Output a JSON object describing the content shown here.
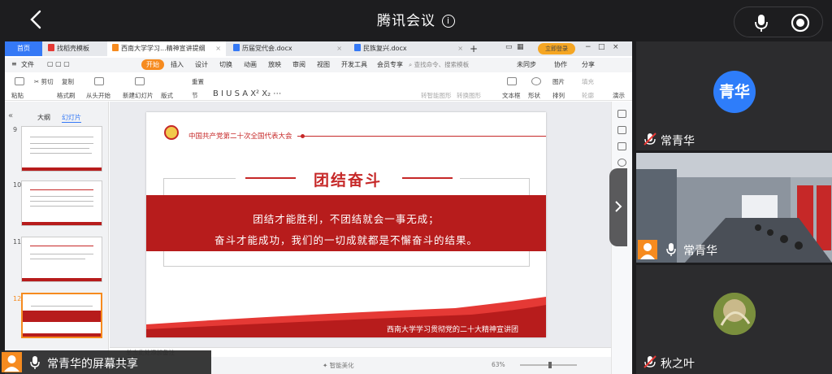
{
  "meeting": {
    "title": "腾讯会议",
    "info_icon": "info-icon"
  },
  "ppt": {
    "tabs": [
      {
        "label": "首页"
      },
      {
        "label": "找稻壳模板"
      },
      {
        "label": "西南大学学习...精神宣讲提纲"
      },
      {
        "label": "历届党代会.docx"
      },
      {
        "label": "民族复兴.docx"
      }
    ],
    "login_label": "立即登录",
    "menu": [
      "文件",
      "开始",
      "插入",
      "设计",
      "切换",
      "动画",
      "放映",
      "审阅",
      "视图",
      "开发工具",
      "会员专享"
    ],
    "search_placeholder": "查找命令、搜索模板",
    "right_actions": [
      "未同步",
      "协作",
      "分享"
    ],
    "ribbon": {
      "paste": "粘贴",
      "cut": "剪切",
      "copy": "复制",
      "format_painter": "格式刷",
      "from_start": "从头开始",
      "new_slide": "新建幻灯片",
      "layout": "版式",
      "section": "节",
      "reset": "重置",
      "textbox": "文本框",
      "shape": "形状",
      "picture": "图片",
      "fill": "填充",
      "arrange": "排列",
      "outline": "轮廓",
      "present": "演示",
      "smart_shape": "转智能图形",
      "convert_graphic": "转换图形"
    },
    "sidebar": {
      "tabs": [
        "大纲",
        "幻灯片"
      ],
      "slides": [
        {
          "num": "9"
        },
        {
          "num": "10"
        },
        {
          "num": "11"
        },
        {
          "num": "12"
        }
      ]
    },
    "slide": {
      "header": "中国共产党第二十次全国代表大会",
      "title": "团结奋斗",
      "line1": "团结才能胜利，不团结就会一事无成；",
      "line2": "奋斗才能成功，我们的一切成就都是不懈奋斗的结果。",
      "footer": "西南大学学习贯彻党的二十大精神宣讲团"
    },
    "notes_placeholder": "单击此处添加备注",
    "status": {
      "smart_beautify": "智能美化",
      "zoom": "63%"
    }
  },
  "share": {
    "label": "常青华的屏幕共享"
  },
  "participants": [
    {
      "avatar_text": "青华",
      "name": "常青华"
    },
    {
      "name": "常青华"
    },
    {
      "name": "秋之叶"
    }
  ],
  "colors": {
    "accent": "#c62828",
    "wps_orange": "#f68b1f",
    "avatar_blue": "#2e7dfa",
    "app_bg": "#1d1d1f"
  }
}
